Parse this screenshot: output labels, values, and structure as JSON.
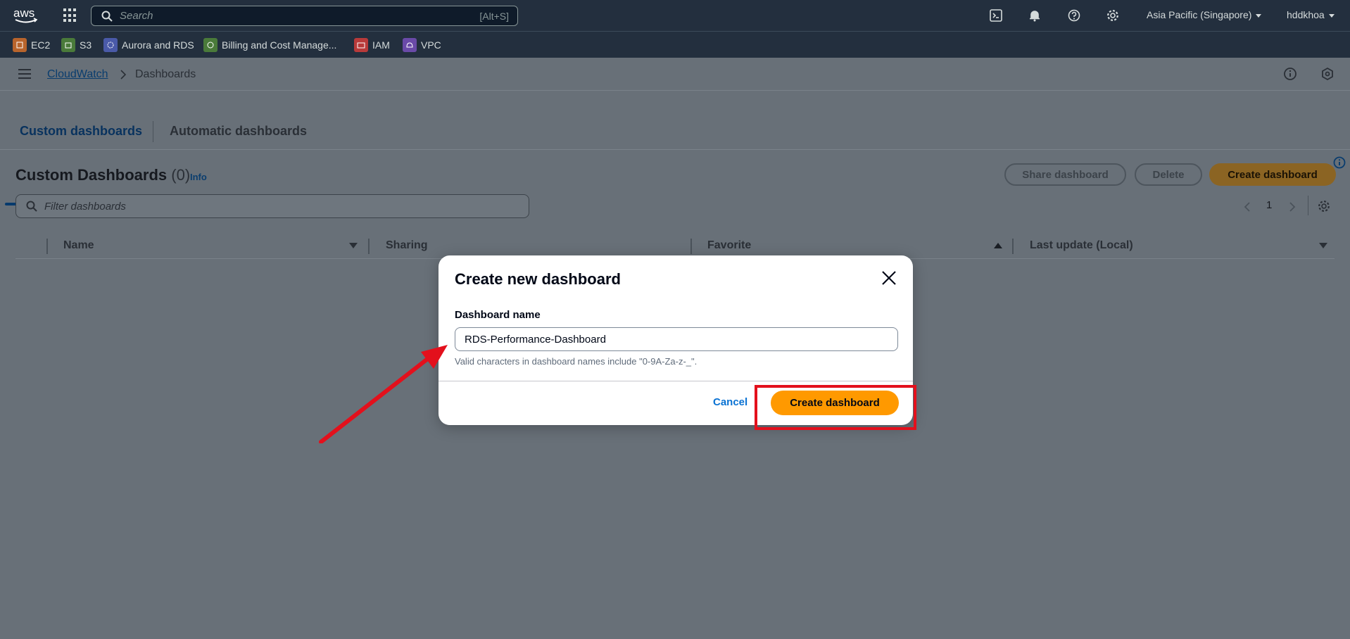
{
  "topnav": {
    "search_placeholder": "Search",
    "search_shortcut": "[Alt+S]",
    "region": "Asia Pacific (Singapore)",
    "user": "hddkhoa",
    "icons": [
      "aws-logo-icon",
      "apps-grid-icon",
      "search-icon",
      "cloudshell-icon",
      "bell-icon",
      "help-icon",
      "gear-icon"
    ]
  },
  "favorites": [
    {
      "label": "EC2",
      "color": "#b8642c"
    },
    {
      "label": "S3",
      "color": "#4a7a3a"
    },
    {
      "label": "Aurora and RDS",
      "color": "#4a5aa8"
    },
    {
      "label": "Billing and Cost Manage...",
      "color": "#4a7a3a"
    },
    {
      "label": "IAM",
      "color": "#b83a3a"
    },
    {
      "label": "VPC",
      "color": "#6a4aa8"
    }
  ],
  "breadcrumb": {
    "service": "CloudWatch",
    "current": "Dashboards"
  },
  "tabs": {
    "custom": "Custom dashboards",
    "automatic": "Automatic dashboards"
  },
  "section": {
    "title": "Custom Dashboards",
    "count": "(0)",
    "info": "Info",
    "share_btn": "Share dashboard",
    "delete_btn": "Delete",
    "create_btn": "Create dashboard",
    "filter_placeholder": "Filter dashboards",
    "page": "1"
  },
  "table": {
    "columns": [
      "Name",
      "Sharing",
      "Favorite",
      "Last update (Local)"
    ]
  },
  "modal": {
    "title": "Create new dashboard",
    "field_label": "Dashboard name",
    "field_value": "RDS-Performance-Dashboard",
    "hint": "Valid characters in dashboard names include \"0-9A-Za-z-_\".",
    "cancel": "Cancel",
    "create": "Create dashboard"
  },
  "colors": {
    "nav_bg": "#232f3e",
    "overlay_bg": "#687078",
    "primary": "#ff9900",
    "link": "#0972d3",
    "annotation": "#e3101c"
  }
}
